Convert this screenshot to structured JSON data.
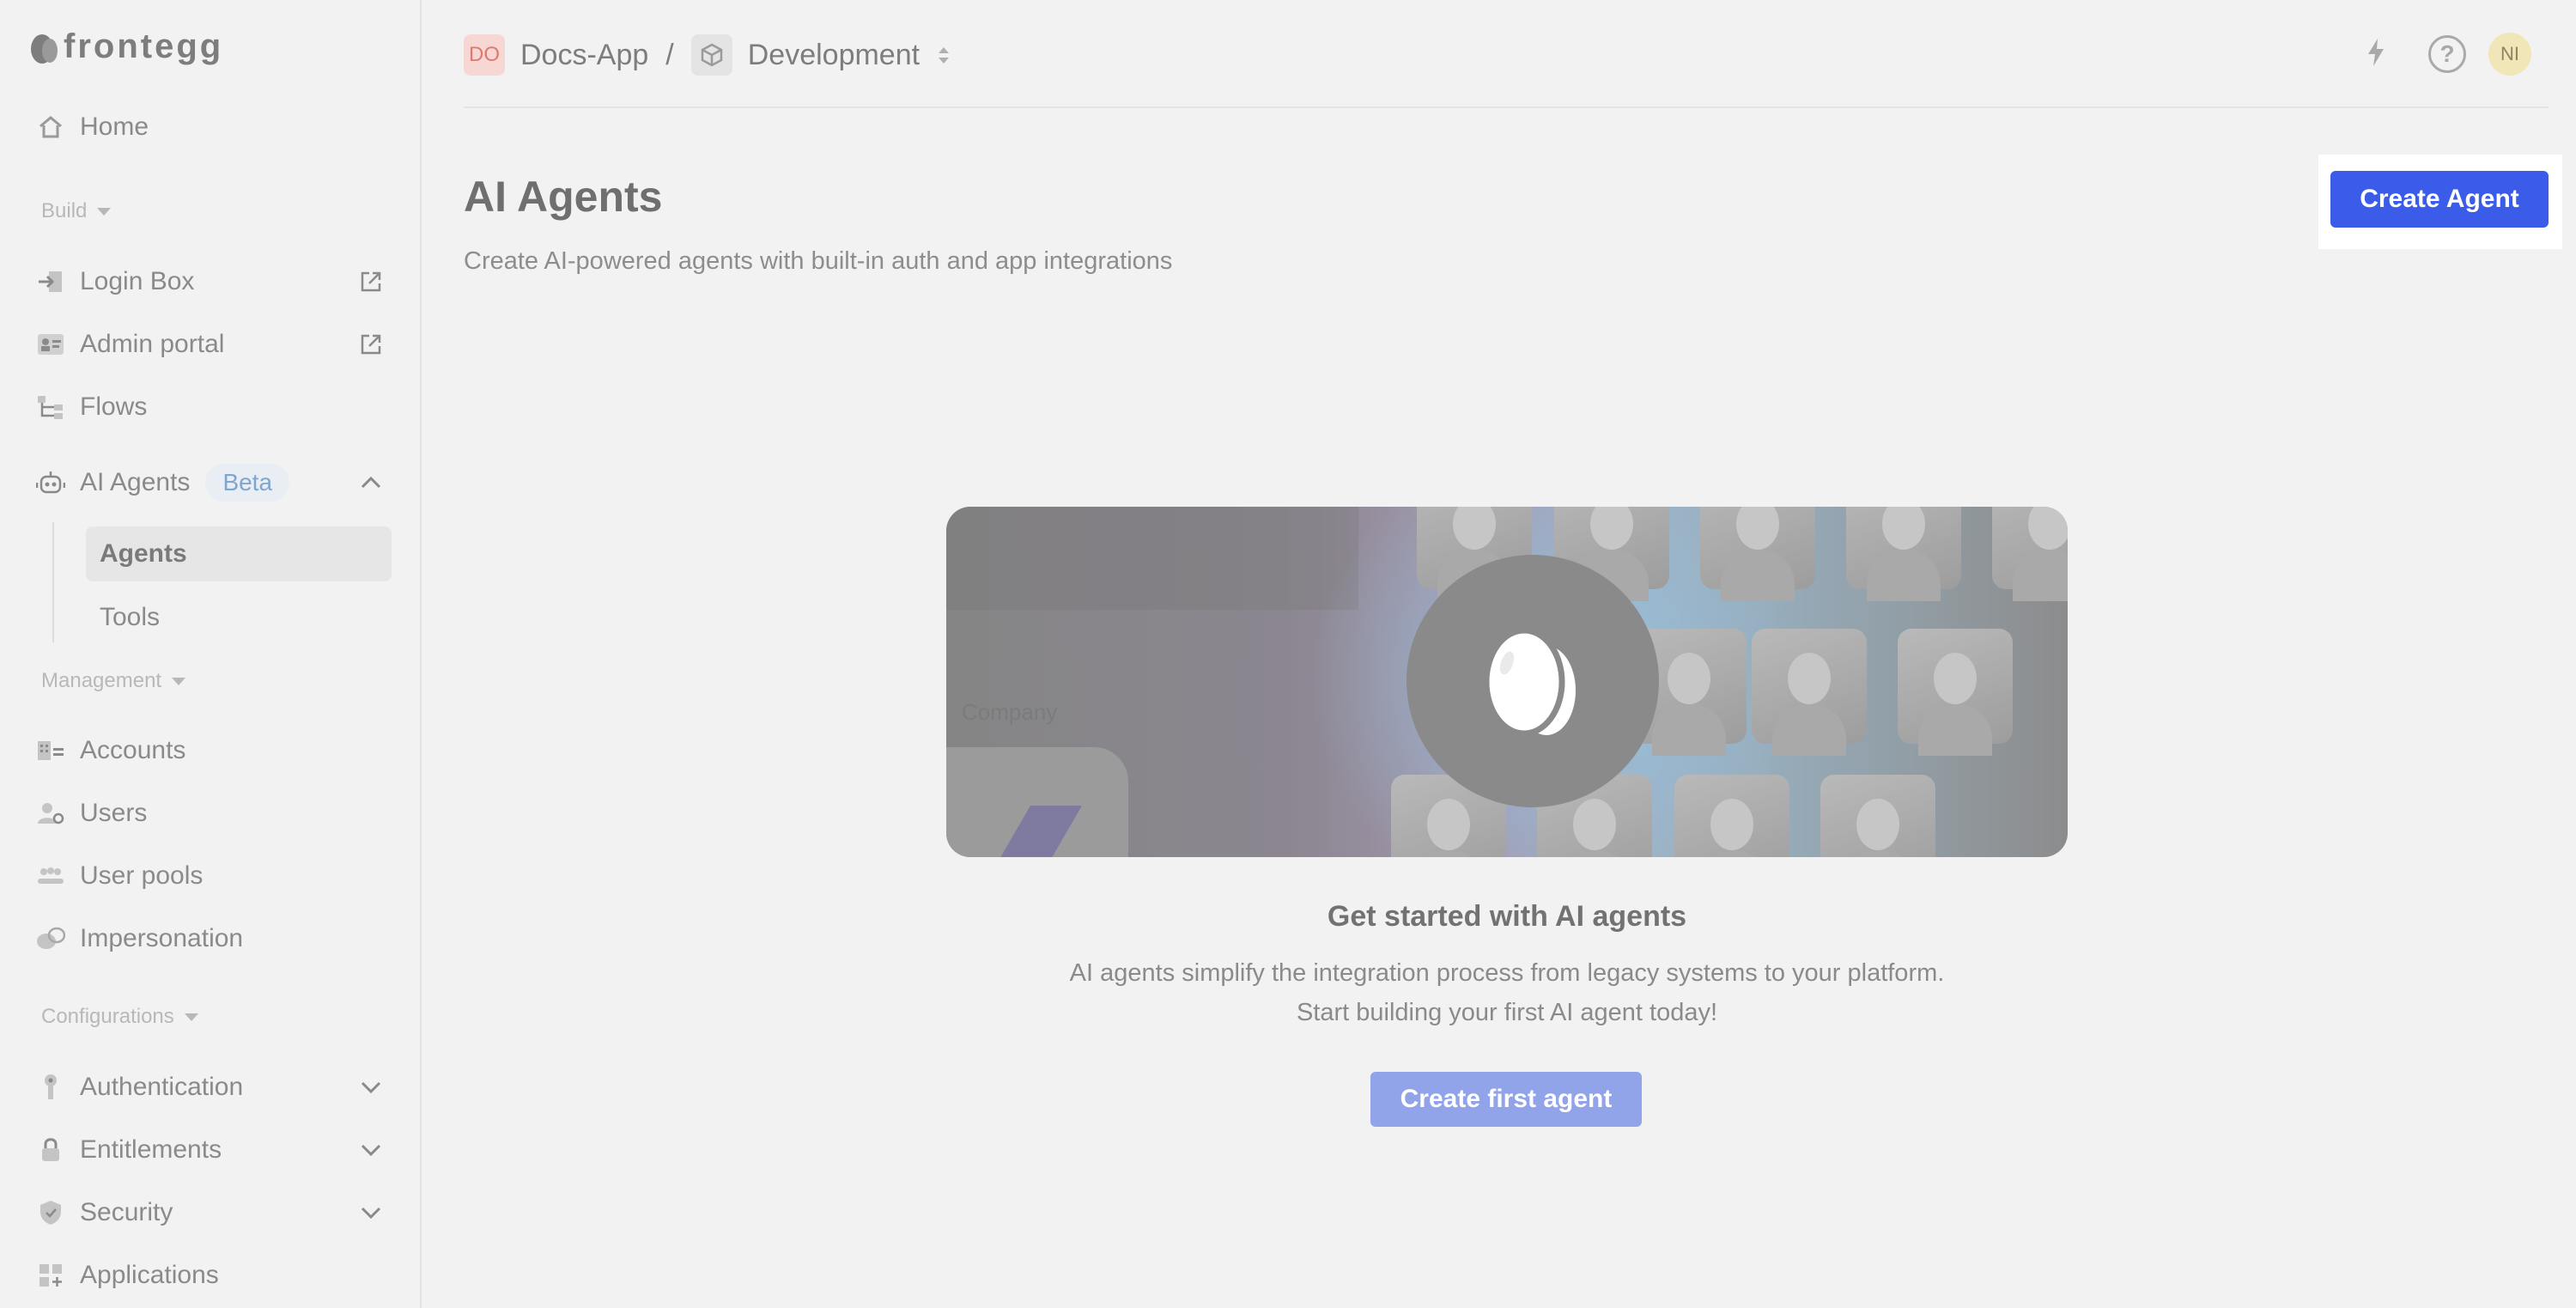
{
  "brand": {
    "name": "frontegg"
  },
  "sidebar": {
    "home": "Home",
    "sections": {
      "build": "Build",
      "management": "Management",
      "configurations": "Configurations"
    },
    "items": {
      "login_box": "Login Box",
      "admin_portal": "Admin portal",
      "flows": "Flows",
      "ai_agents": "AI Agents",
      "ai_agents_badge": "Beta",
      "agents": "Agents",
      "tools": "Tools",
      "accounts": "Accounts",
      "users": "Users",
      "user_pools": "User pools",
      "impersonation": "Impersonation",
      "authentication": "Authentication",
      "entitlements": "Entitlements",
      "security": "Security",
      "applications": "Applications"
    }
  },
  "header": {
    "app_initials": "DO",
    "app_name": "Docs-App",
    "separator": "/",
    "environment": "Development",
    "help_symbol": "?",
    "user_initials": "NI"
  },
  "page": {
    "title": "AI Agents",
    "subtitle": "Create AI-powered agents with built-in auth and app integrations",
    "create_button": "Create Agent"
  },
  "empty_state": {
    "hero_label": "Company",
    "title": "Get started with AI agents",
    "line1": "AI agents simplify the integration process from legacy systems to your platform.",
    "line2": "Start building your first AI agent today!",
    "button": "Create first agent"
  }
}
